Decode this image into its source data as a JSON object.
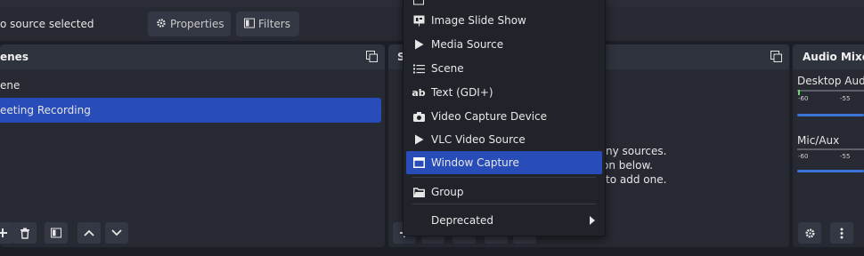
{
  "toolbar": {
    "source_status": "o source selected",
    "properties_label": "Properties",
    "filters_label": "Filters"
  },
  "scenes": {
    "title": "enes",
    "items": [
      {
        "label": "ene"
      },
      {
        "label": "eeting Recording",
        "selected": true
      }
    ]
  },
  "sources": {
    "title": "S",
    "empty_lines": [
      "ny sources.",
      "on below.",
      "to add one."
    ]
  },
  "context_menu": {
    "items": [
      {
        "label": "Image Slide Show",
        "icon": "slideshow-icon"
      },
      {
        "label": "Media Source",
        "icon": "play-icon"
      },
      {
        "label": "Scene",
        "icon": "list-icon"
      },
      {
        "label": "Text (GDI+)",
        "icon": "text-icon"
      },
      {
        "label": "Video Capture Device",
        "icon": "camera-icon"
      },
      {
        "label": "VLC Video Source",
        "icon": "play-icon"
      },
      {
        "label": "Window Capture",
        "icon": "window-icon",
        "highlighted": true
      },
      {
        "label": "Group",
        "icon": "folder-icon"
      },
      {
        "label": "Deprecated",
        "icon": "",
        "submenu": true
      }
    ]
  },
  "audio_mixer": {
    "title": "Audio Mixe",
    "channels": [
      {
        "name": "Desktop Audio",
        "ticks": [
          "-60",
          "-55"
        ]
      },
      {
        "name": "Mic/Aux",
        "ticks": [
          "-60",
          "-55"
        ]
      }
    ]
  },
  "colors": {
    "accent": "#284cb8",
    "panel": "#272a33",
    "background": "#1d1f26",
    "volume": "#3b74d6"
  }
}
